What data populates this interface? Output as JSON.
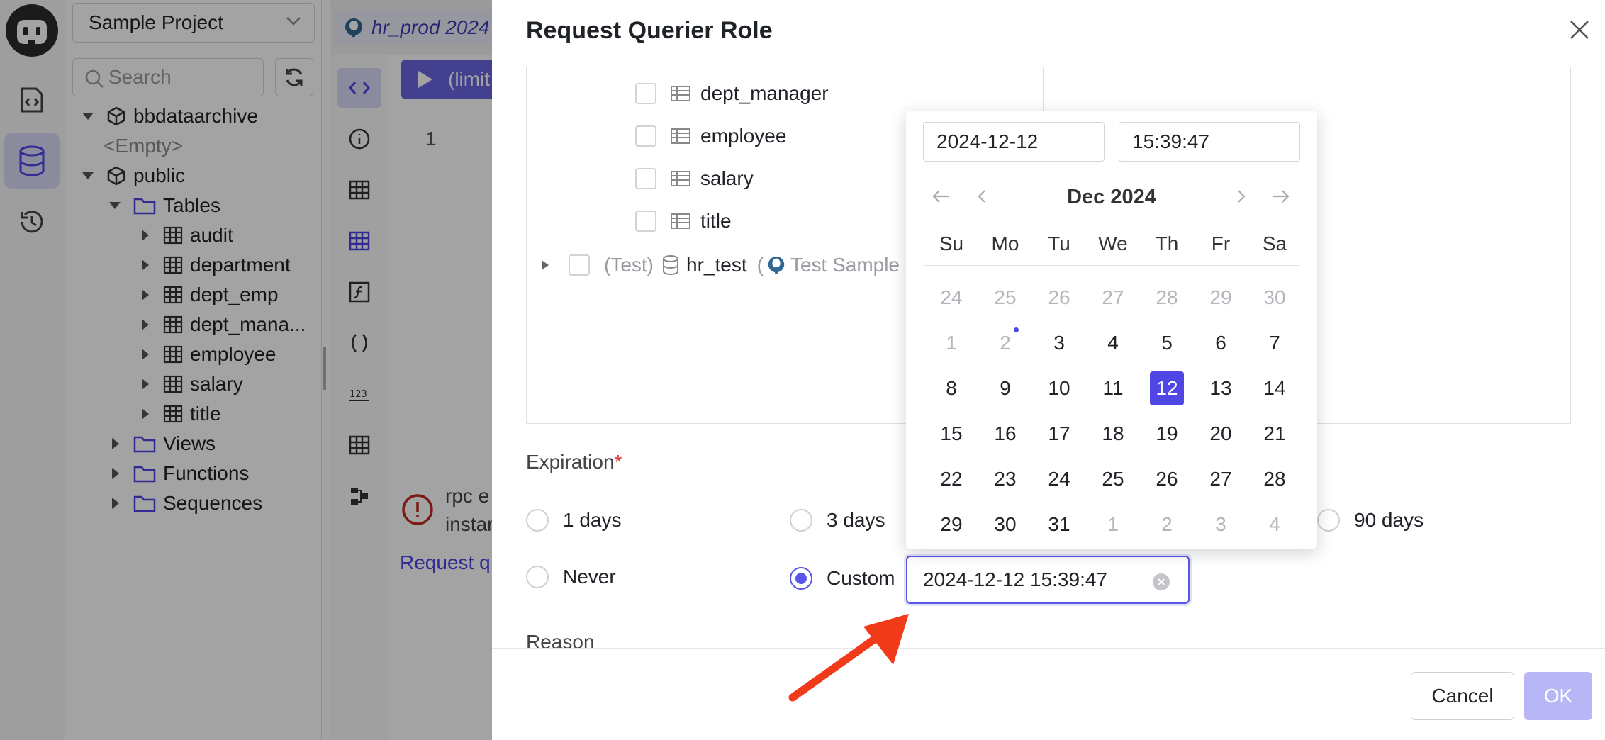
{
  "sidebar": {
    "project": "Sample Project",
    "search_placeholder": "Search",
    "tree": {
      "db_archive": "bbdataarchive",
      "empty": "<Empty>",
      "schema": "public",
      "tables_folder": "Tables",
      "tables": [
        "audit",
        "department",
        "dept_emp",
        "dept_mana...",
        "employee",
        "salary",
        "title"
      ],
      "views": "Views",
      "functions": "Functions",
      "sequences": "Sequences"
    }
  },
  "editor": {
    "tab_label": "hr_prod 2024",
    "run_label": "(limit",
    "line_number": "1",
    "error_line1": "rpc e",
    "error_line2": "instar",
    "request_link": "Request q"
  },
  "drawer": {
    "title": "Request Querier Role",
    "tables": [
      "dept_manager",
      "employee",
      "salary",
      "title"
    ],
    "db_row": {
      "env": "(Test)",
      "name": "hr_test",
      "paren": "(",
      "instance": "Test Sample"
    },
    "expiration_label": "Expiration",
    "required_mark": "*",
    "options": {
      "d1": "1 days",
      "d3": "3 days",
      "d90": "90 days",
      "never": "Never",
      "custom": "Custom"
    },
    "selected_option": "Custom",
    "custom_value": "2024-12-12 15:39:47",
    "reason_label": "Reason",
    "cancel": "Cancel",
    "ok": "OK"
  },
  "datepicker": {
    "date": "2024-12-12",
    "time": "15:39:47",
    "month": "Dec 2024",
    "weekdays": [
      "Su",
      "Mo",
      "Tu",
      "We",
      "Th",
      "Fr",
      "Sa"
    ],
    "weeks": [
      [
        "24",
        "25",
        "26",
        "27",
        "28",
        "29",
        "30"
      ],
      [
        "1",
        "2",
        "3",
        "4",
        "5",
        "6",
        "7"
      ],
      [
        "8",
        "9",
        "10",
        "11",
        "12",
        "13",
        "14"
      ],
      [
        "15",
        "16",
        "17",
        "18",
        "19",
        "20",
        "21"
      ],
      [
        "22",
        "23",
        "24",
        "25",
        "26",
        "27",
        "28"
      ],
      [
        "29",
        "30",
        "31",
        "1",
        "2",
        "3",
        "4"
      ]
    ],
    "selected_day": "12",
    "today_day": "2",
    "colors": {
      "accent": "#4f46e5",
      "annotation_arrow": "#f03a1a"
    }
  }
}
